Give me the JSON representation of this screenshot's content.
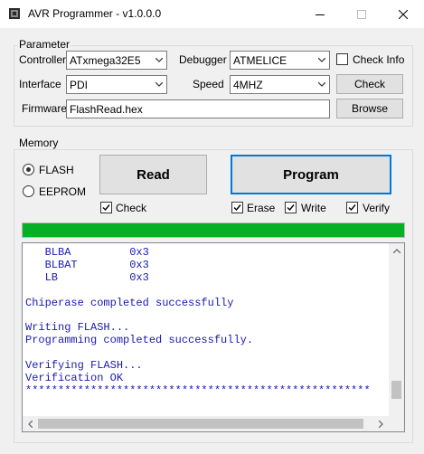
{
  "window": {
    "title": "AVR Programmer - v1.0.0.0"
  },
  "parameter": {
    "group_label": "Parameter",
    "controller_label": "Controller",
    "controller_value": "ATxmega32E5",
    "debugger_label": "Debugger",
    "debugger_value": "ATMELICE",
    "check_info_label": "Check Info",
    "check_info_checked": false,
    "interface_label": "Interface",
    "interface_value": "PDI",
    "speed_label": "Speed",
    "speed_value": "4MHZ",
    "check_button_label": "Check",
    "firmware_label": "Firmware",
    "firmware_value": "FlashRead.hex",
    "browse_button_label": "Browse"
  },
  "memory": {
    "group_label": "Memory",
    "flash_label": "FLASH",
    "eeprom_label": "EEPROM",
    "selected": "FLASH",
    "read_button_label": "Read",
    "program_button_label": "Program",
    "check_label": "Check",
    "erase_label": "Erase",
    "write_label": "Write",
    "verify_label": "Verify",
    "progress_percent": 100
  },
  "log": {
    "lines": [
      "   BLBA         0x3",
      "   BLBAT        0x3",
      "   LB           0x3",
      "",
      "Chiperase completed successfully",
      "",
      "Writing FLASH...",
      "Programming completed successfully.",
      "",
      "Verifying FLASH...",
      "Verification OK",
      "*****************************************************"
    ]
  },
  "colors": {
    "progress_fill": "#06b025",
    "log_text": "#1a1ab0",
    "focus_border": "#0078d7"
  }
}
